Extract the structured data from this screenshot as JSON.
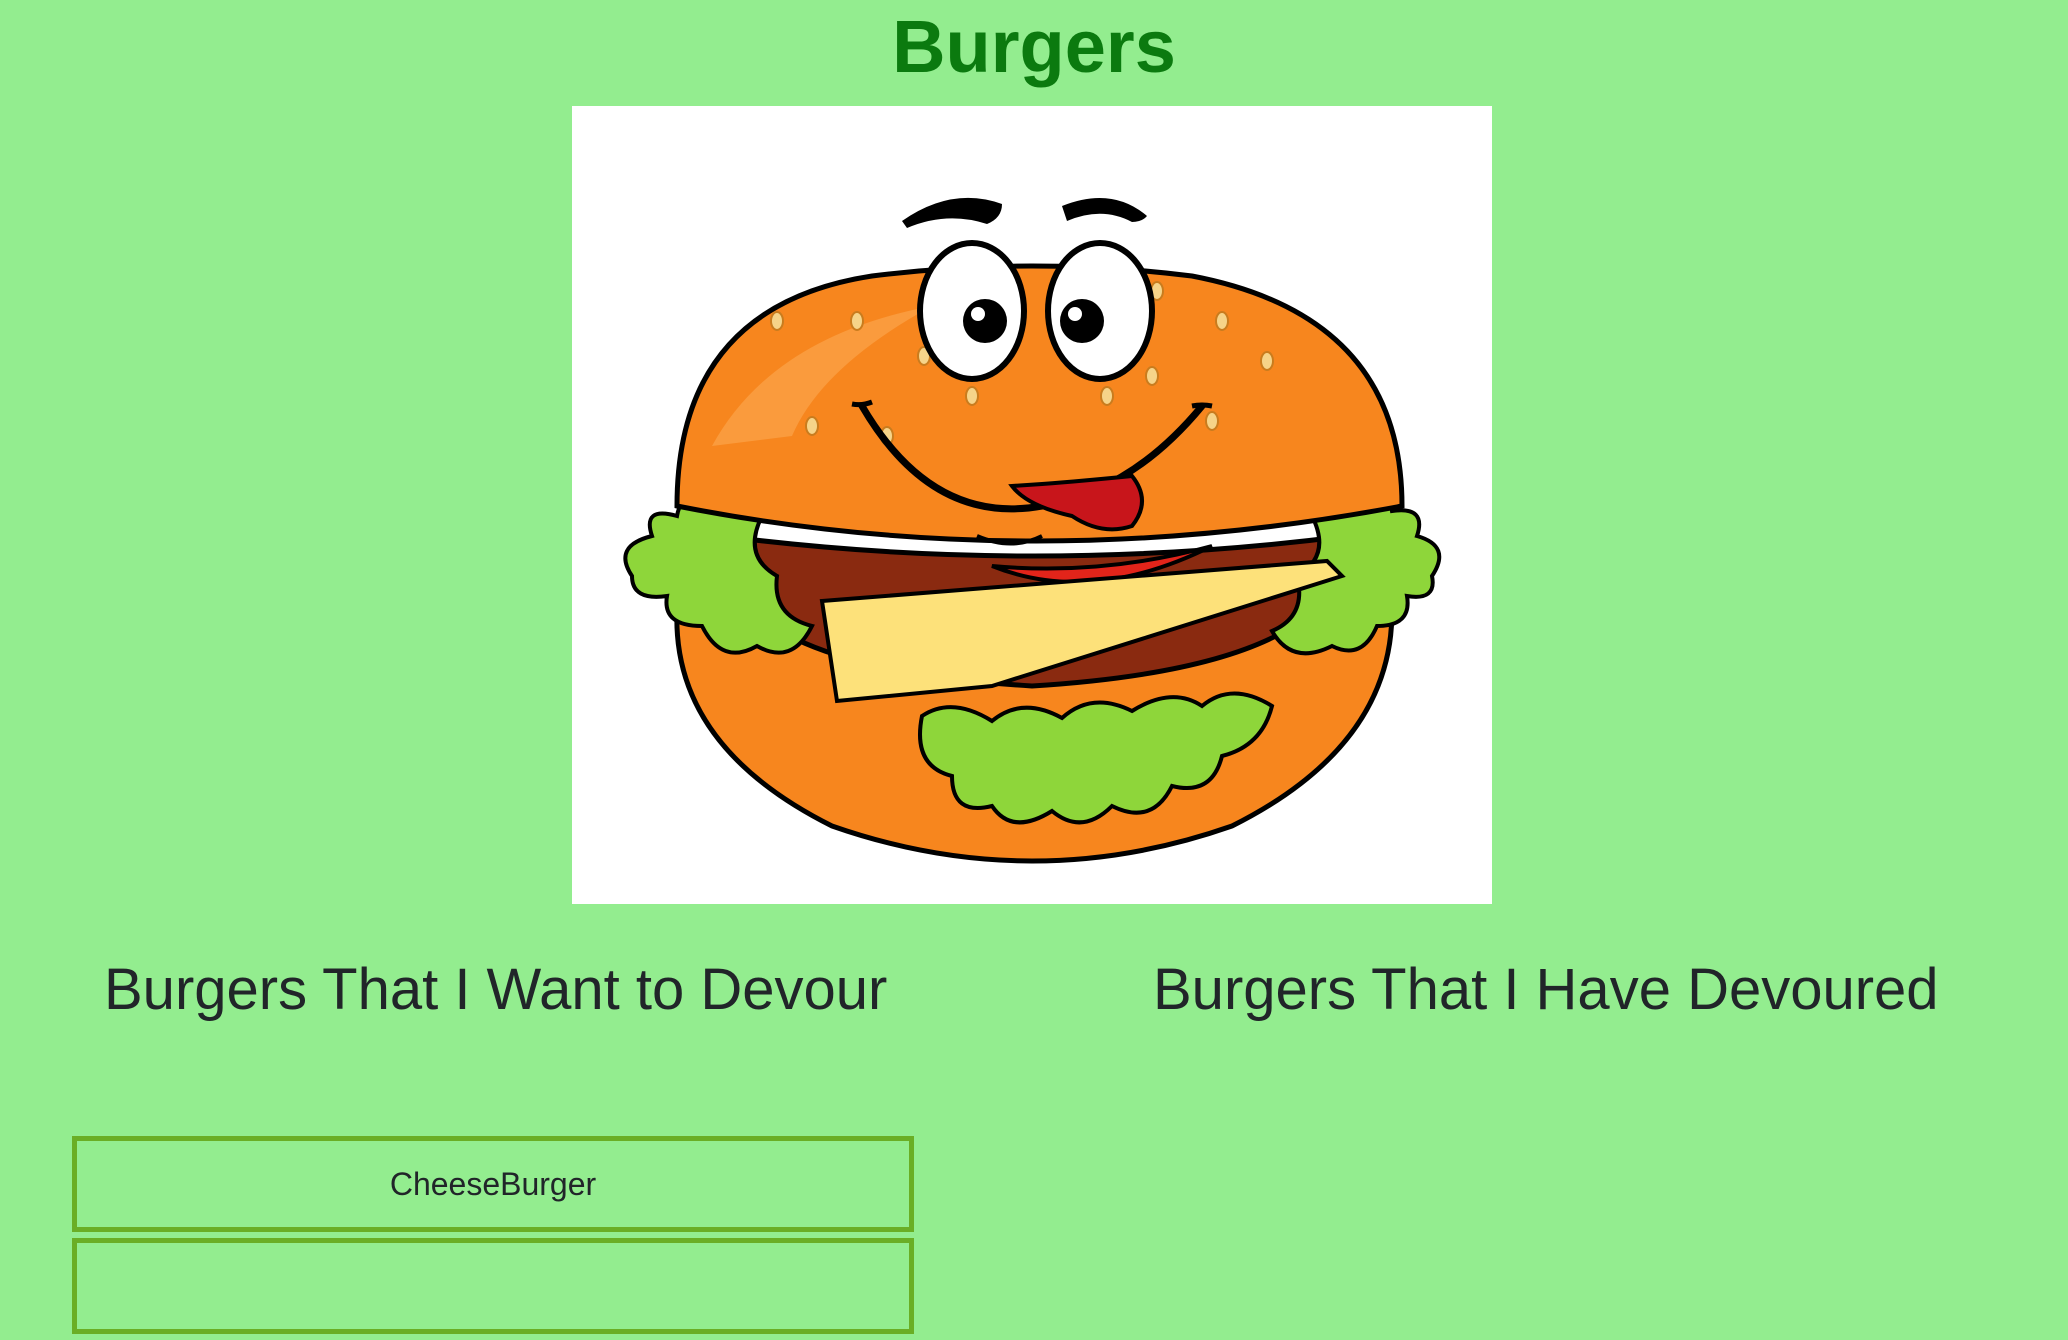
{
  "header": {
    "title": "Burgers"
  },
  "hero": {
    "icon": "cartoon-burger-mascot"
  },
  "columns": {
    "to_devour_heading": "Burgers That I Want to Devour",
    "devoured_heading": "Burgers That I Have Devoured"
  },
  "to_devour": {
    "items": [
      {
        "name": "CheeseBurger"
      },
      {
        "name": ""
      }
    ]
  },
  "colors": {
    "background": "#93ed8f",
    "title": "#0b7a0f",
    "item_border": "#6aae25"
  }
}
